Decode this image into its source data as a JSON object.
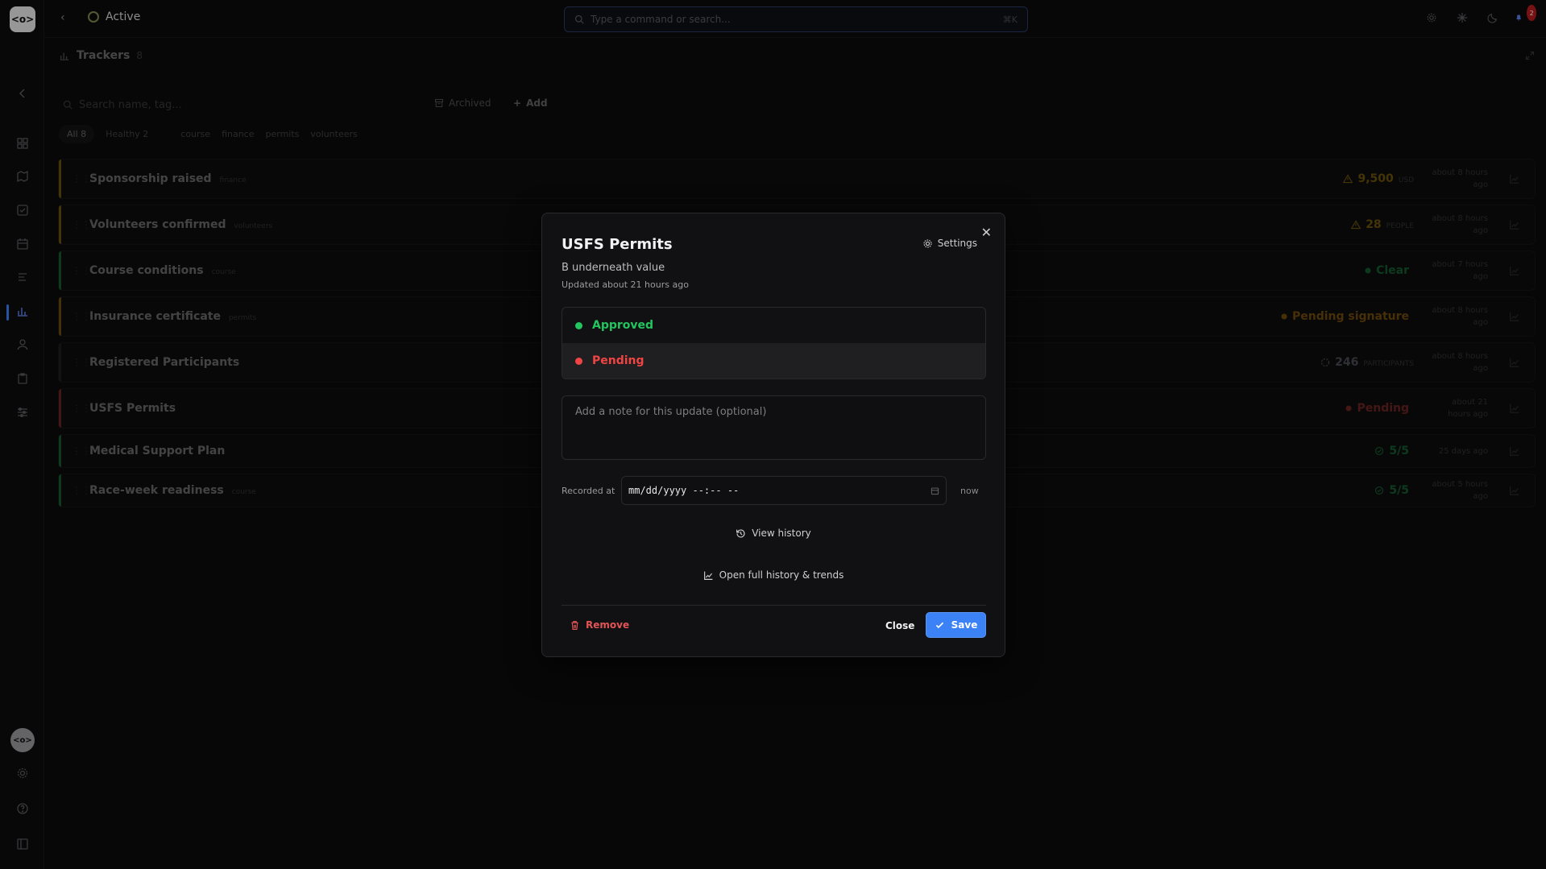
{
  "topbar": {
    "breadcrumb": "Active",
    "search_placeholder": "Type a command or search...",
    "search_shortcut": "⌘K",
    "notification_count": "2"
  },
  "sidebar": {
    "logo": "<o>",
    "avatar": "<o>"
  },
  "trackers": {
    "title": "Trackers",
    "count": "8",
    "search_placeholder": "Search name, tag...",
    "archived_label": "Archived",
    "add_label": "Add",
    "filters": [
      {
        "label": "All",
        "count": "8"
      },
      {
        "label": "Healthy",
        "count": "2"
      },
      {
        "label": "course"
      },
      {
        "label": "finance"
      },
      {
        "label": "permits"
      },
      {
        "label": "volunteers"
      }
    ],
    "rows": [
      {
        "name": "Sponsorship raised",
        "tag": "finance",
        "value": "9,500",
        "unit": "USD",
        "time": "about 8 hours ago",
        "value_color": "#eab308",
        "accent": "#eab308",
        "icon": "warning-icon"
      },
      {
        "name": "Volunteers confirmed",
        "tag": "volunteers",
        "value": "28",
        "unit": "PEOPLE",
        "time": "about 8 hours ago",
        "value_color": "#eab308",
        "accent": "#eab308",
        "icon": "warning-icon"
      },
      {
        "name": "Course conditions",
        "tag": "course",
        "value": "Clear",
        "unit": "",
        "time": "about 7 hours ago",
        "value_color": "#22c55e",
        "accent": "#22c55e",
        "icon": "dot-icon"
      },
      {
        "name": "Insurance certificate",
        "tag": "permits",
        "value": "Pending signature",
        "unit": "",
        "time": "about 8 hours ago",
        "value_color": "#f59e0b",
        "accent": "#f59e0b",
        "icon": "dot-icon"
      },
      {
        "name": "Registered Participants",
        "tag": "",
        "value": "246",
        "unit": "PARTICIPANTS",
        "time": "about 8 hours ago",
        "value_color": "#9ca3af",
        "accent": "#3a3a3f",
        "icon": "progress-icon"
      },
      {
        "name": "USFS Permits",
        "tag": "",
        "value": "Pending",
        "unit": "",
        "time": "about 21 hours ago",
        "value_color": "#ef4444",
        "accent": "#ef4444",
        "icon": "dot-icon"
      },
      {
        "name": "Medical Support Plan",
        "tag": "",
        "value": "5/5",
        "unit": "",
        "time": "25 days ago",
        "value_color": "#22c55e",
        "accent": "#22c55e",
        "icon": "check-circle-icon"
      },
      {
        "name": "Race-week readiness",
        "tag": "course",
        "value": "5/5",
        "unit": "",
        "time": "about 5 hours ago",
        "value_color": "#22c55e",
        "accent": "#22c55e",
        "icon": "check-circle-icon"
      }
    ]
  },
  "modal": {
    "title": "USFS Permits",
    "settings_label": "Settings",
    "subtitle": "B underneath value",
    "updated": "Updated about 21 hours ago",
    "options": [
      {
        "label": "Approved",
        "color": "#22c55e",
        "selected": false
      },
      {
        "label": "Pending",
        "color": "#ef4444",
        "selected": true
      }
    ],
    "note_placeholder": "Add a note for this update (optional)",
    "recorded_label": "Recorded at",
    "recorded_value": "mm/dd/yyyy --:-- --",
    "now_label": "now",
    "view_history": "View history",
    "open_full": "Open full history & trends",
    "remove_label": "Remove",
    "close_label": "Close",
    "save_label": "Save"
  },
  "colors": {
    "accent_blue": "#3b82f6",
    "danger_red": "#e25555"
  }
}
